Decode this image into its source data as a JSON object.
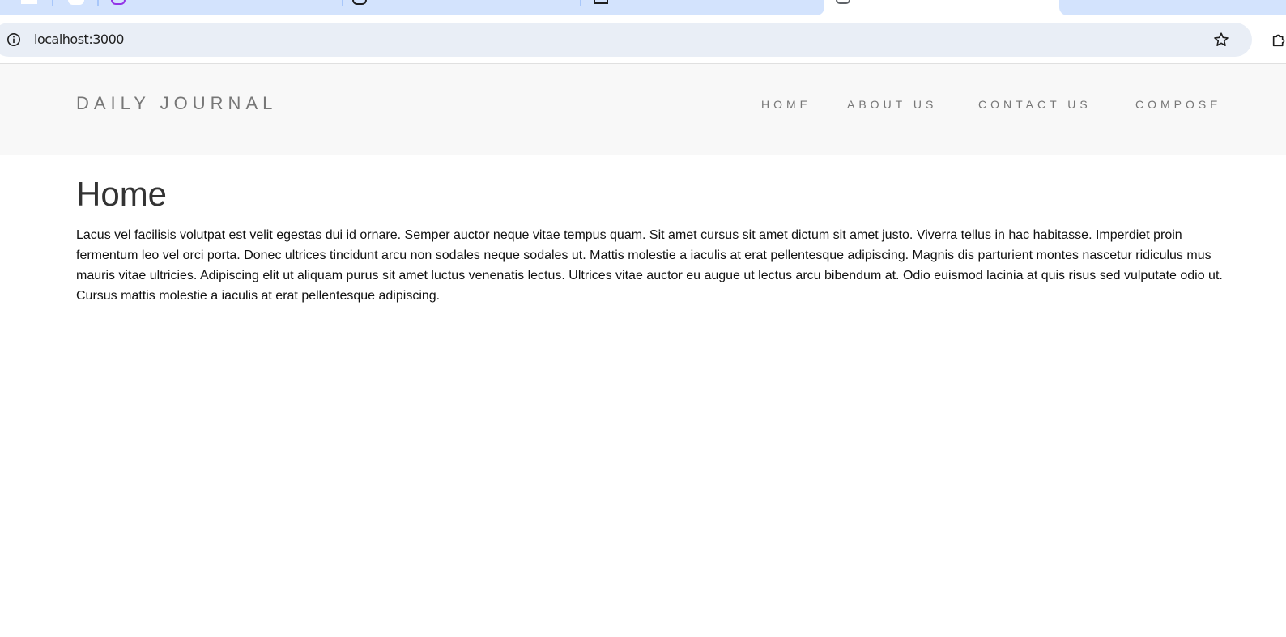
{
  "browser": {
    "url": "localhost:3000"
  },
  "site": {
    "brand": "DAILY JOURNAL",
    "nav": [
      {
        "label": "HOME"
      },
      {
        "label": "ABOUT US"
      },
      {
        "label": "CONTACT US"
      },
      {
        "label": "COMPOSE"
      }
    ]
  },
  "page": {
    "title": "Home",
    "body": "Lacus vel facilisis volutpat est velit egestas dui id ornare. Semper auctor neque vitae tempus quam. Sit amet cursus sit amet dictum sit amet justo. Viverra tellus in hac habitasse. Imperdiet proin fermentum leo vel orci porta. Donec ultrices tincidunt arcu non sodales neque sodales ut. Mattis molestie a iaculis at erat pellentesque adipiscing. Magnis dis parturient montes nascetur ridiculus mus mauris vitae ultricies. Adipiscing elit ut aliquam purus sit amet luctus venenatis lectus. Ultrices vitae auctor eu augue ut lectus arcu bibendum at. Odio euismod lacinia at quis risus sed vulputate odio ut. Cursus mattis molestie a iaculis at erat pellentesque adipiscing."
  },
  "icons": {
    "info": "info-icon",
    "bookmark": "star-icon",
    "extensions": "puzzle-icon"
  },
  "colors": {
    "tabstrip": "#d3e3fd",
    "omnibox": "#e9eef6",
    "navbar": "#f8f8f8",
    "nav_text": "#777777"
  }
}
